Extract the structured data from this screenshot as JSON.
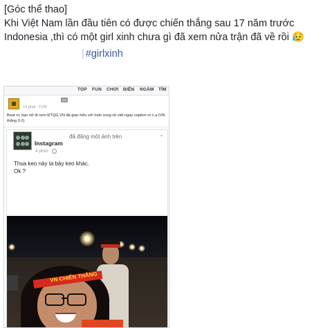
{
  "post": {
    "line1": "[Góc thể thao]",
    "line2": "Khi Việt Nam lần đầu tiên có được chiến thắng sau 17 năm trước",
    "line3": "Indonesia ,thì có một girl xinh chưa gì đã xem nửa trận đã về rồi 😥",
    "hashtag": "#girlxinh"
  },
  "screenshot": {
    "nav": [
      "TOP",
      "FUN",
      "CHƠI",
      "ĐIỆN",
      "NGẦM",
      "TÍM"
    ],
    "page_time": "14 phút · FUN",
    "badge": "Q&",
    "beat_text": "Beat ơi, bạn nữ đi xem ĐTQG VN đá giao hữu với Indo xong về viết ngay caption nt n a (VN thắng 3-2)",
    "instagram": {
      "name": "Instagram",
      "action": "đã đăng một ảnh trên",
      "time": "4 phút ·",
      "caption_line1": "Thua keo này ta bày keo khác.",
      "caption_line2": "Ok ?"
    },
    "photo_band_text": "VN CHIẾN THẮNG"
  },
  "colors": {
    "text": "#1d2129",
    "link": "#365899",
    "meta": "#90949c"
  }
}
